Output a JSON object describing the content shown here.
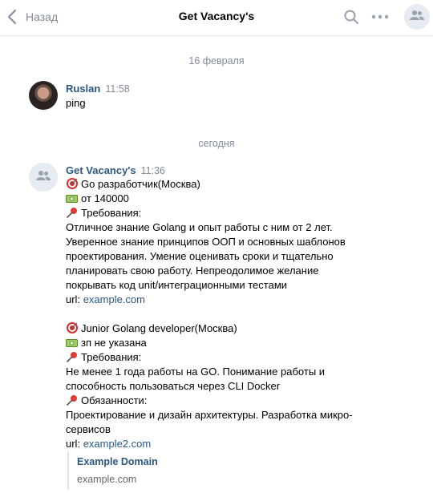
{
  "header": {
    "back_label": "Назад",
    "title": "Get Vacancy's",
    "icons": [
      "chevron-left-icon",
      "search-icon",
      "more-icon",
      "group-icon"
    ]
  },
  "dates": {
    "first": "16 февраля",
    "second": "сегодня"
  },
  "messages": [
    {
      "author": "Ruslan",
      "time": "11:58",
      "text": "ping"
    },
    {
      "author": "Get Vacancy's",
      "time": "11:36",
      "lines": [
        "Go разработчик(Москва)",
        "от 140000",
        "Требования:",
        "Отличное знание Golang и опыт работы с ним от 2 лет.",
        "Уверенное знание принципов ООП и основных шаблонов",
        "проектирования. Умение оценивать сроки и тщательно",
        "планировать свою работу. Непреодолимое желание",
        "покрывать код unit/интеграционными тестами",
        "url:",
        "example.com",
        "Junior Golang developer(Москва)",
        "зп не указана",
        "Требования:",
        "Не менее 1 года работы на GO. Понимание работы и",
        "способность пользоваться через CLI Docker",
        "Обязанности:",
        "Проектирование и дизайн архитектуры. Разработка микро-",
        "сервисов",
        "url:",
        "example2.com"
      ],
      "snippet": {
        "title": "Example Domain",
        "url": "example.com"
      }
    }
  ],
  "colors": {
    "accent": "#2a5885",
    "muted": "#828a99",
    "divider": "#e7e8ec",
    "avatar_bg": "#e5ebf1"
  }
}
